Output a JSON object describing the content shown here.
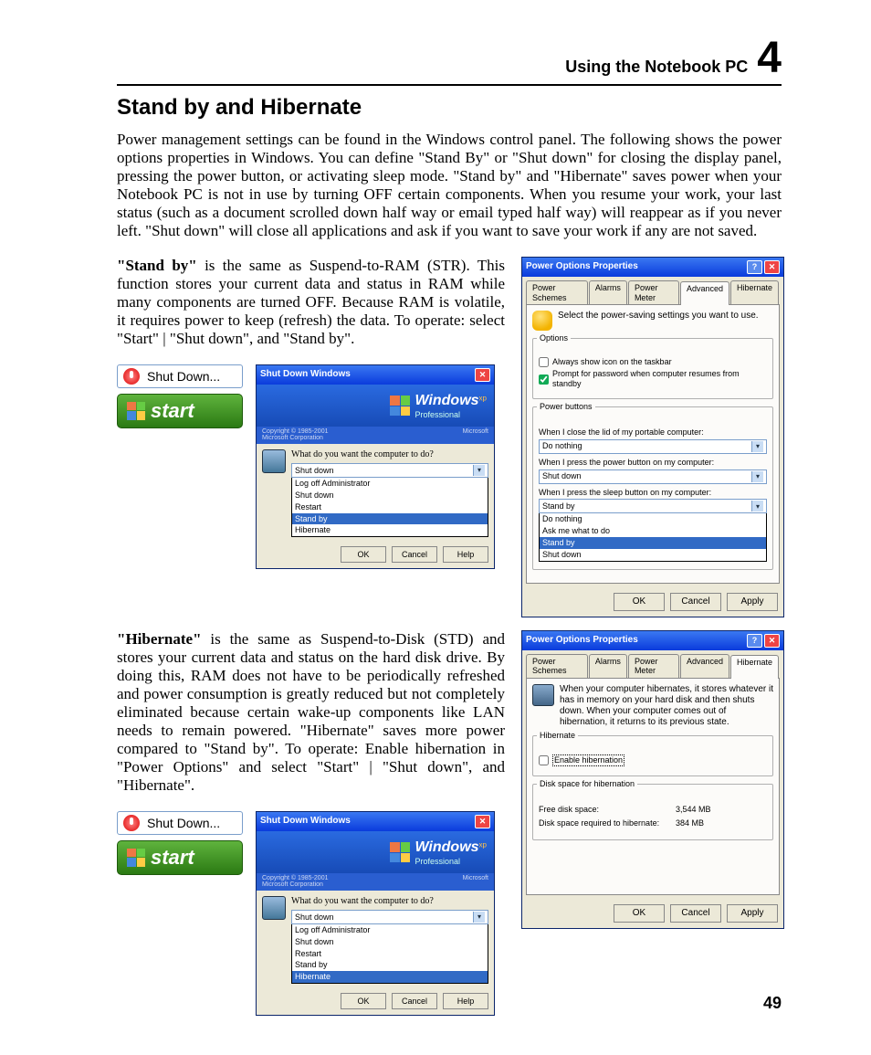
{
  "header": {
    "title": "Using the Notebook PC",
    "chapter": "4"
  },
  "h1": "Stand by and Hibernate",
  "intro": "Power management settings can be found in the Windows control panel. The following shows the power options properties in Windows. You can define \"Stand By\" or \"Shut down\" for closing the display panel, pressing the power button, or activating sleep mode. \"Stand by\" and \"Hibernate\" saves power when your Notebook PC is not in use by turning OFF certain components. When you resume your work, your last status (such as a document scrolled down half way or email typed half way) will reappear as if you never left. \"Shut down\" will close all applications and ask if you want to save your work if any are not saved.",
  "standby": {
    "lead": "\"Stand by\"",
    "body": " is the same as Suspend-to-RAM (STR). This function stores your current data and status in RAM while many components are turned OFF. Because RAM is volatile, it requires power to keep (refresh) the data. To operate: select \"Start\" | \"Shut down\", and \"Stand by\"."
  },
  "hibernate": {
    "lead": "\"Hibernate\"",
    "body": " is the same as  Suspend-to-Disk (STD) and stores your current data and status on the hard disk drive. By doing this, RAM does not have to be periodically refreshed and power consumption is greatly reduced but not completely eliminated because certain wake-up components like LAN needs to remain powered. \"Hibernate\" saves more power compared to \"Stand by\". To operate: Enable hibernation in \"Power Options\" and select \"Start\" | \"Shut down\", and \"Hibernate\"."
  },
  "startmenu": {
    "shutdown": "Shut Down...",
    "start": "start"
  },
  "sdw": {
    "title": "Shut Down Windows",
    "brand": "Windows",
    "brand_sup": "xp",
    "brand_sub": "Professional",
    "copy_l": "Copyright © 1985-2001",
    "copy_l2": "Microsoft Corporation",
    "copy_r": "Microsoft",
    "question": "What do you want the computer to do?",
    "selected": "Shut down",
    "opts": [
      "Log off Administrator",
      "Shut down",
      "Restart",
      "Stand by",
      "Hibernate"
    ],
    "sel1": "Stand by",
    "sel2": "Hibernate",
    "ok": "OK",
    "cancel": "Cancel",
    "help": "Help"
  },
  "pop_adv": {
    "title": "Power Options Properties",
    "tabs": [
      "Power Schemes",
      "Alarms",
      "Power Meter",
      "Advanced",
      "Hibernate"
    ],
    "active": "Advanced",
    "desc": "Select the power-saving settings you want to use.",
    "grp_options": "Options",
    "chk1": "Always show icon on the taskbar",
    "chk2": "Prompt for password when computer resumes from standby",
    "grp_pb": "Power buttons",
    "lbl_lid": "When I close the lid of my portable computer:",
    "val_lid": "Do nothing",
    "lbl_pwr": "When I press the power button on my computer:",
    "val_pwr": "Shut down",
    "lbl_slp": "When I press the sleep button on my computer:",
    "val_slp": "Stand by",
    "list": [
      "Do nothing",
      "Ask me what to do",
      "Stand by",
      "Shut down"
    ],
    "ok": "OK",
    "cancel": "Cancel",
    "apply": "Apply"
  },
  "pop_hib": {
    "title": "Power Options Properties",
    "tabs": [
      "Power Schemes",
      "Alarms",
      "Power Meter",
      "Advanced",
      "Hibernate"
    ],
    "active": "Hibernate",
    "desc": "When your computer hibernates, it stores whatever it has in memory on your hard disk and then shuts down. When your computer comes out of hibernation, it returns to its previous state.",
    "grp_h": "Hibernate",
    "chk": "Enable hibernation",
    "grp_d": "Disk space for hibernation",
    "k1": "Free disk space:",
    "v1": "3,544 MB",
    "k2": "Disk space required to hibernate:",
    "v2": "384 MB",
    "ok": "OK",
    "cancel": "Cancel",
    "apply": "Apply"
  },
  "page_number": "49"
}
